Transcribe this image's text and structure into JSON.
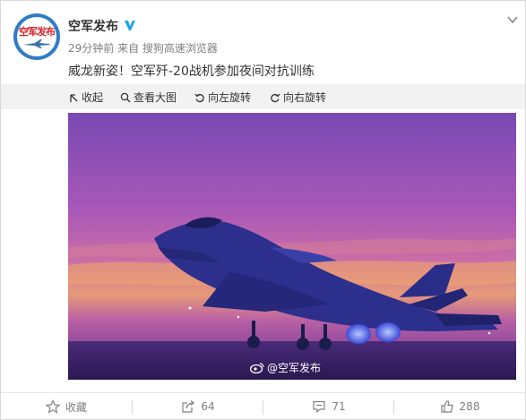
{
  "post": {
    "author": "空军发布",
    "avatar_text": "空军发布",
    "time": "29分钟前",
    "source": "来自 搜狗高速浏览器",
    "text": "威龙新姿！空军歼-20战机参加夜间对抗训练",
    "image_watermark": "@空军发布"
  },
  "toolbar": {
    "collapse": "收起",
    "view_large": "查看大图",
    "rotate_left": "向左旋转",
    "rotate_right": "向右旋转"
  },
  "actions": {
    "favorite": "收藏",
    "repost_count": "64",
    "comment_count": "71",
    "like_count": "288"
  },
  "colors": {
    "accent": "#eb7350",
    "verified": "#1da1f2",
    "link": "#333333"
  }
}
